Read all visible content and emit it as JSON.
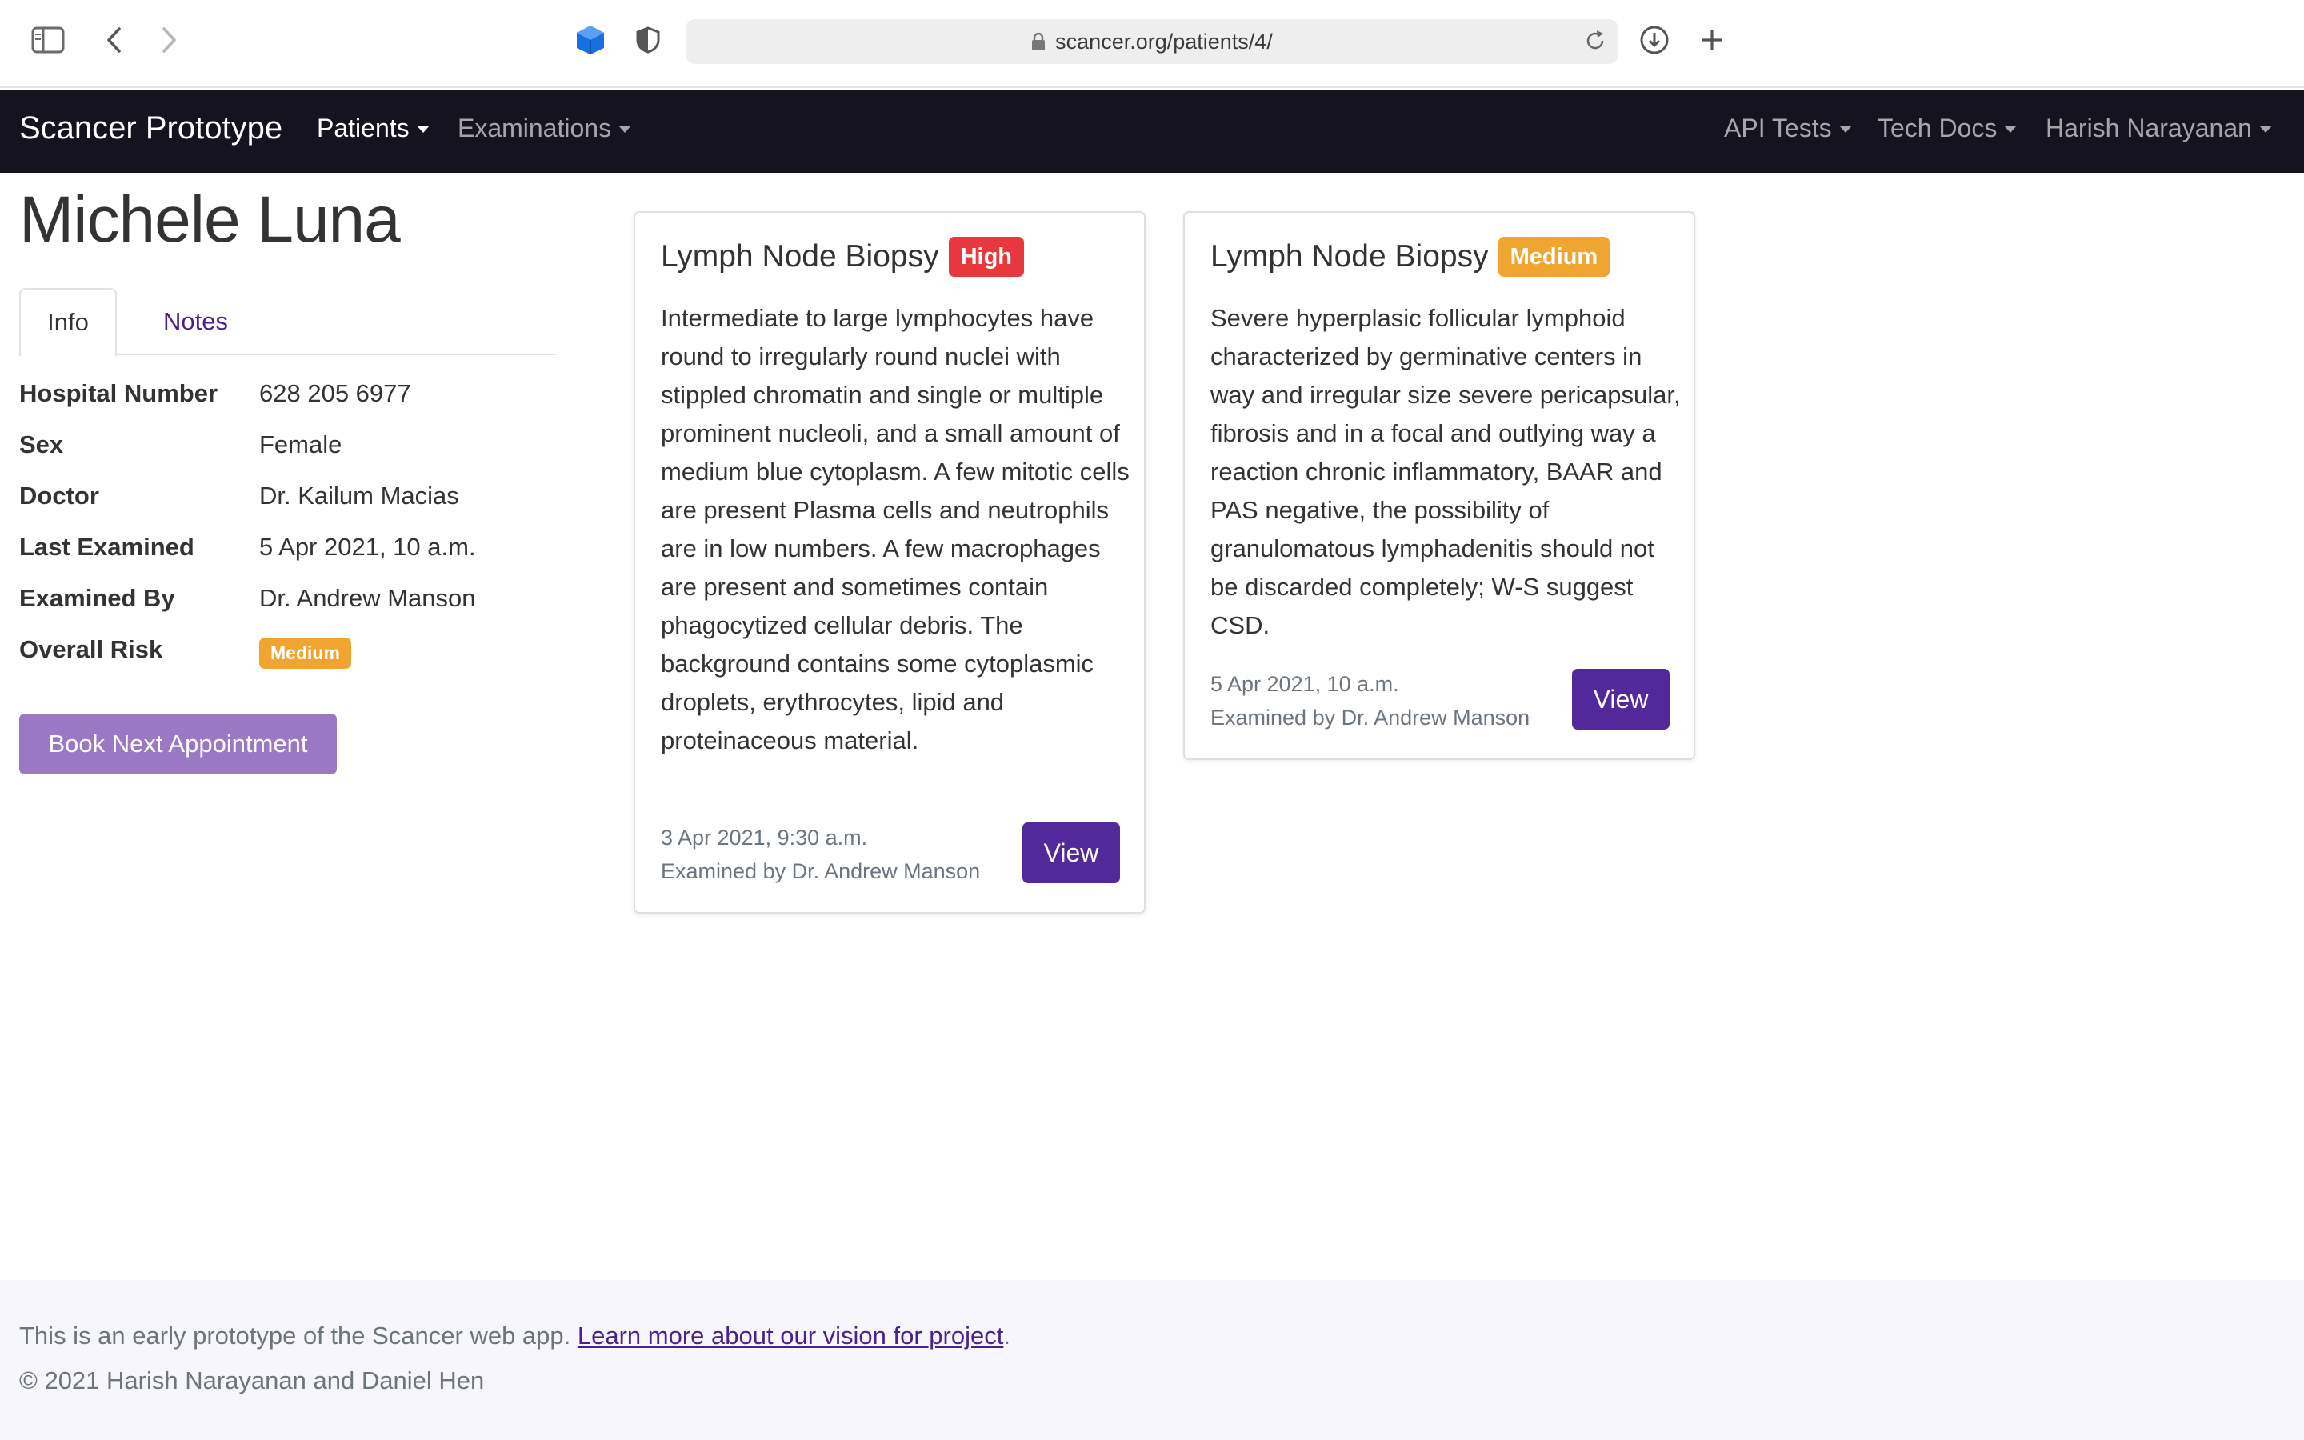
{
  "browser": {
    "url": "scancer.org/patients/4/",
    "icons": [
      "sidebar-icon",
      "back-icon",
      "forward-icon",
      "cube-extension-icon",
      "shield-icon",
      "lock-icon",
      "reload-icon",
      "download-icon",
      "new-tab-icon"
    ]
  },
  "navbar": {
    "brand": "Scancer Prototype",
    "left_items": [
      {
        "label": "Patients",
        "active": true
      },
      {
        "label": "Examinations",
        "active": false
      }
    ],
    "right_items": [
      {
        "label": "API Tests"
      },
      {
        "label": "Tech Docs"
      },
      {
        "label": "Harish Narayanan"
      }
    ]
  },
  "patient": {
    "name": "Michele Luna",
    "tabs": [
      {
        "label": "Info",
        "active": true
      },
      {
        "label": "Notes",
        "active": false
      }
    ],
    "info": [
      {
        "label": "Hospital Number",
        "value": "628 205 6977"
      },
      {
        "label": "Sex",
        "value": "Female"
      },
      {
        "label": "Doctor",
        "value": "Dr. Kailum Macias"
      },
      {
        "label": "Last Examined",
        "value": "5 Apr 2021, 10 a.m."
      },
      {
        "label": "Examined By",
        "value": "Dr. Andrew Manson"
      },
      {
        "label": "Overall Risk",
        "value": "Medium"
      }
    ],
    "book_button": "Book Next Appointment"
  },
  "examinations": [
    {
      "title": "Lymph Node Biopsy",
      "risk": "High",
      "risk_color": "#e8383d",
      "text": "Intermediate to large lymphocytes have round to irregularly round nuclei with stippled chromatin and single or multiple prominent nucleoli, and a small amount of medium blue cytoplasm. A few mitotic cells are present Plasma cells and neutrophils are in low numbers. A few macrophages are present and sometimes contain phagocytized cellular debris. The background contains some cytoplasmic droplets, erythrocytes, lipid and proteinaceous material.",
      "date": "3 Apr 2021, 9:30 a.m.",
      "examiner": "Examined by Dr. Andrew Manson",
      "view_label": "View"
    },
    {
      "title": "Lymph Node Biopsy",
      "risk": "Medium",
      "risk_color": "#f0a531",
      "text": "Severe hyperplasic follicular lymphoid characterized by germinative centers in way and irregular size severe pericapsular, fibrosis and in a focal and outlying way a reaction chronic inflammatory, BAAR and PAS negative, the possibility of granulomatous lymphadenitis should not be discarded completely; W-S suggest CSD.",
      "date": "5 Apr 2021, 10 a.m.",
      "examiner": "Examined by Dr. Andrew Manson",
      "view_label": "View"
    }
  ],
  "footer": {
    "text": "This is an early prototype of the Scancer web app.",
    "link": "Learn more about our vision for project",
    "period": ".",
    "copyright": "© 2021 Harish Narayanan and Daniel Hen"
  },
  "colors": {
    "navbar_bg": "#15131f",
    "primary": "#53289b",
    "primary_light": "#9a78c4",
    "high": "#e8383d",
    "medium": "#f0a531"
  }
}
